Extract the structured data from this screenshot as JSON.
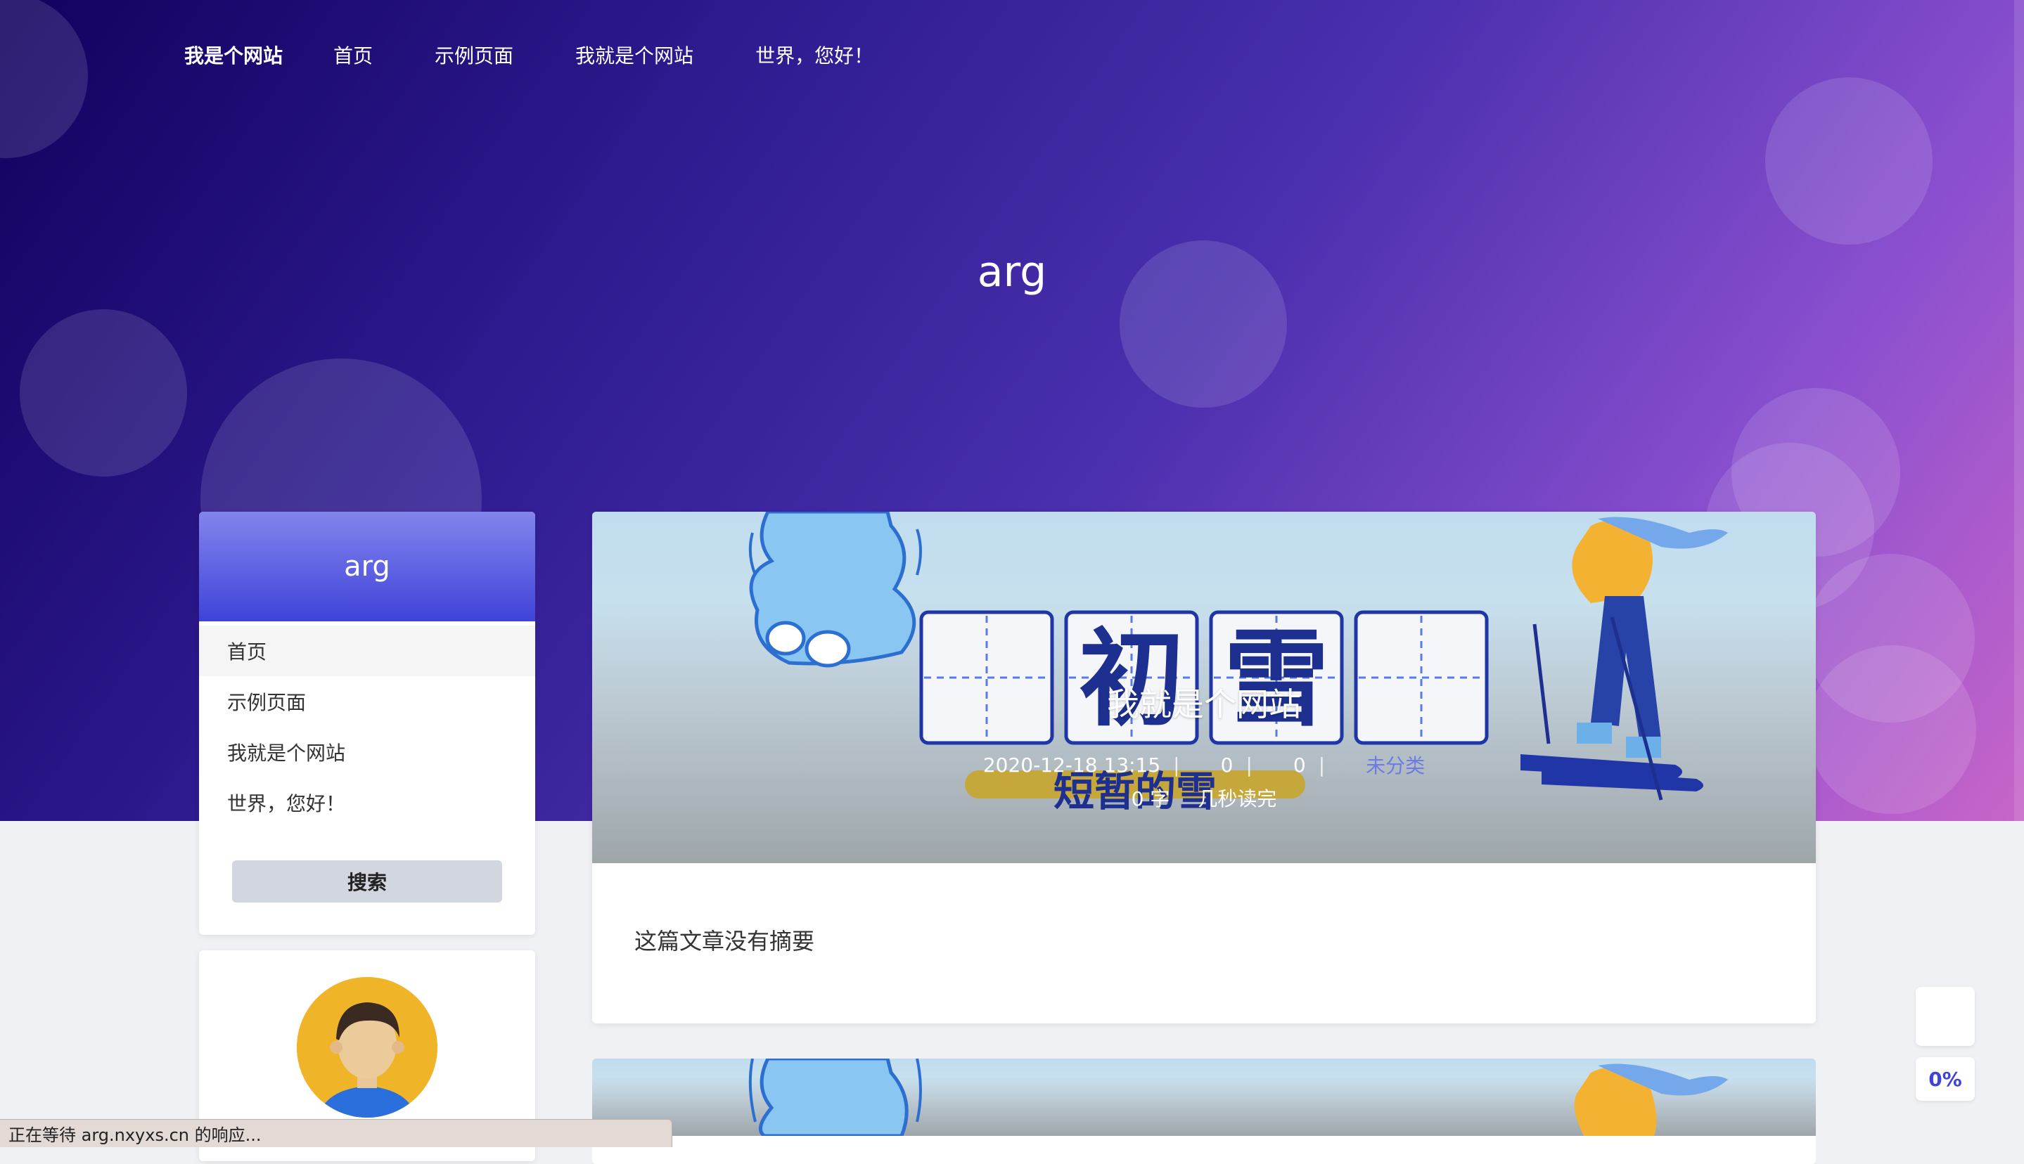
{
  "nav": {
    "brand": "我是个网站",
    "items": [
      "首页",
      "示例页面",
      "我就是个网站",
      "世界，您好！"
    ]
  },
  "hero": {
    "title": "arg"
  },
  "sidebar": {
    "header": "arg",
    "items": [
      {
        "label": "首页",
        "active": true
      },
      {
        "label": "示例页面",
        "active": false
      },
      {
        "label": "我就是个网站",
        "active": false
      },
      {
        "label": "世界，您好！",
        "active": false
      }
    ],
    "search_label": "搜索"
  },
  "post": {
    "title": "我就是个网站",
    "date": "2020-12-18 13:15",
    "views": "0",
    "comments": "0",
    "category": "未分类",
    "word_count": "0 字",
    "read_time": "几秒读完",
    "excerpt": "这篇文章没有摘要",
    "cover": {
      "art_chars": [
        "初",
        "雪"
      ],
      "art_subtitle": "短暂的雪"
    }
  },
  "widgets": {
    "progress": "0%"
  },
  "status": "正在等待 arg.nxyxs.cn 的响应..."
}
